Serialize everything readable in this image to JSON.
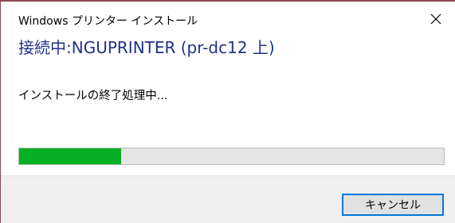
{
  "window": {
    "title": "Windows プリンター インストール",
    "close_icon": "close-icon"
  },
  "dialog": {
    "main_instruction": "接続中:NGUPRINTER (pr-dc12 上)",
    "status": "インストールの終了処理中...",
    "progress": 0.24
  },
  "buttons": {
    "cancel_label": "キャンセル"
  },
  "colors": {
    "accent_text": "#1e3287",
    "progress_fill": "#06b025",
    "progress_track": "#e6e6e6",
    "focus_border": "#0078d7",
    "footer_bg": "#f0f0f0",
    "window_border": "#8a4b55"
  }
}
